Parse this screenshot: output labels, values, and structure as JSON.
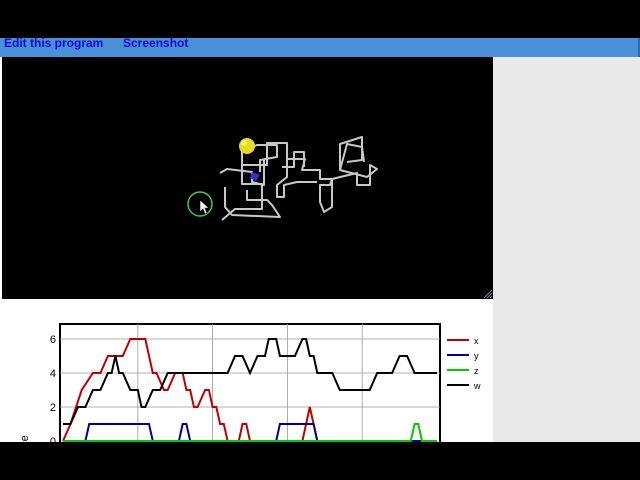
{
  "toolbar": {
    "edit_label": "Edit this program",
    "screenshot_label": "Screenshot"
  },
  "scene": {
    "background": "#000000",
    "ball_color": "#e6dc1e",
    "path_color": "#c8c8c8",
    "marker_color": "#3b2bd0",
    "cursor_ring_color": "#3cc85a"
  },
  "chart_data": {
    "type": "line",
    "ylabel": "ce",
    "ytick_labels": [
      "0",
      "2",
      "4",
      "6"
    ],
    "ylim": [
      0,
      7
    ],
    "xlim": [
      0,
      100
    ],
    "grid": true,
    "legend_placement": "right",
    "colors": {
      "x": "#c00000",
      "y": "#0000a0",
      "z": "#00cc00",
      "w": "#000000"
    },
    "series": [
      {
        "name": "x",
        "x": [
          0,
          2,
          5,
          8,
          10,
          12,
          14,
          16,
          18,
          20,
          22,
          24,
          25,
          27,
          28,
          30,
          32,
          33,
          34,
          35,
          36,
          38,
          39,
          40,
          41,
          42,
          43,
          44,
          45,
          46,
          47,
          48,
          49,
          50,
          51,
          52,
          53,
          55,
          56,
          57,
          58,
          59,
          60,
          62,
          64,
          65,
          66,
          67,
          68,
          70,
          72,
          74,
          75,
          76,
          77,
          78,
          80,
          82,
          84,
          86,
          88,
          90,
          92,
          94,
          96,
          98,
          100
        ],
        "y": [
          0,
          1,
          3,
          4,
          4,
          5,
          5,
          5,
          6,
          6,
          6,
          4,
          4,
          3,
          3,
          4,
          4,
          3,
          3,
          2,
          2,
          3,
          3,
          2,
          2,
          1,
          1,
          0,
          0,
          0,
          0,
          1,
          1,
          0,
          0,
          0,
          0,
          0,
          0,
          0,
          0,
          0,
          0,
          0,
          0,
          1,
          2,
          1,
          0,
          0,
          0,
          0,
          0,
          0,
          0,
          0,
          0,
          0,
          0,
          0,
          0,
          0,
          0,
          0,
          0,
          0,
          0
        ]
      },
      {
        "name": "y",
        "x": [
          0,
          5,
          6,
          7,
          8,
          10,
          15,
          20,
          22,
          23,
          24,
          26,
          28,
          30,
          31,
          32,
          33,
          34,
          35,
          36,
          40,
          50,
          56,
          57,
          58,
          60,
          62,
          65,
          66,
          67,
          68,
          70,
          75,
          80,
          90,
          100
        ],
        "y": [
          0,
          0,
          0,
          1,
          1,
          1,
          1,
          1,
          1,
          1,
          0,
          0,
          0,
          0,
          0,
          1,
          1,
          0,
          0,
          0,
          0,
          0,
          0,
          0,
          1,
          1,
          1,
          1,
          1,
          1,
          0,
          0,
          0,
          0,
          0,
          0
        ]
      },
      {
        "name": "z",
        "x": [
          0,
          80,
          92,
          93,
          94,
          95,
          96,
          100
        ],
        "y": [
          0,
          0,
          0,
          0,
          1,
          1,
          0,
          0
        ]
      },
      {
        "name": "w",
        "x": [
          0,
          2,
          4,
          5,
          6,
          8,
          10,
          12,
          13,
          14,
          15,
          16,
          18,
          20,
          21,
          22,
          24,
          26,
          28,
          30,
          32,
          34,
          36,
          38,
          40,
          42,
          44,
          46,
          48,
          50,
          52,
          54,
          55,
          56,
          57,
          58,
          60,
          62,
          64,
          65,
          66,
          67,
          68,
          70,
          72,
          74,
          75,
          76,
          78,
          80,
          82,
          84,
          86,
          88,
          90,
          92,
          94,
          96,
          98,
          100
        ],
        "y": [
          1,
          1,
          2,
          2,
          2,
          3,
          3,
          4,
          4,
          5,
          4,
          4,
          3,
          3,
          2,
          2,
          3,
          3,
          4,
          4,
          4,
          4,
          4,
          4,
          4,
          4,
          4,
          5,
          5,
          4,
          5,
          5,
          6,
          6,
          6,
          5,
          5,
          5,
          6,
          6,
          5,
          5,
          4,
          4,
          4,
          3,
          3,
          3,
          3,
          3,
          3,
          4,
          4,
          4,
          5,
          5,
          4,
          4,
          4,
          4
        ]
      }
    ]
  }
}
